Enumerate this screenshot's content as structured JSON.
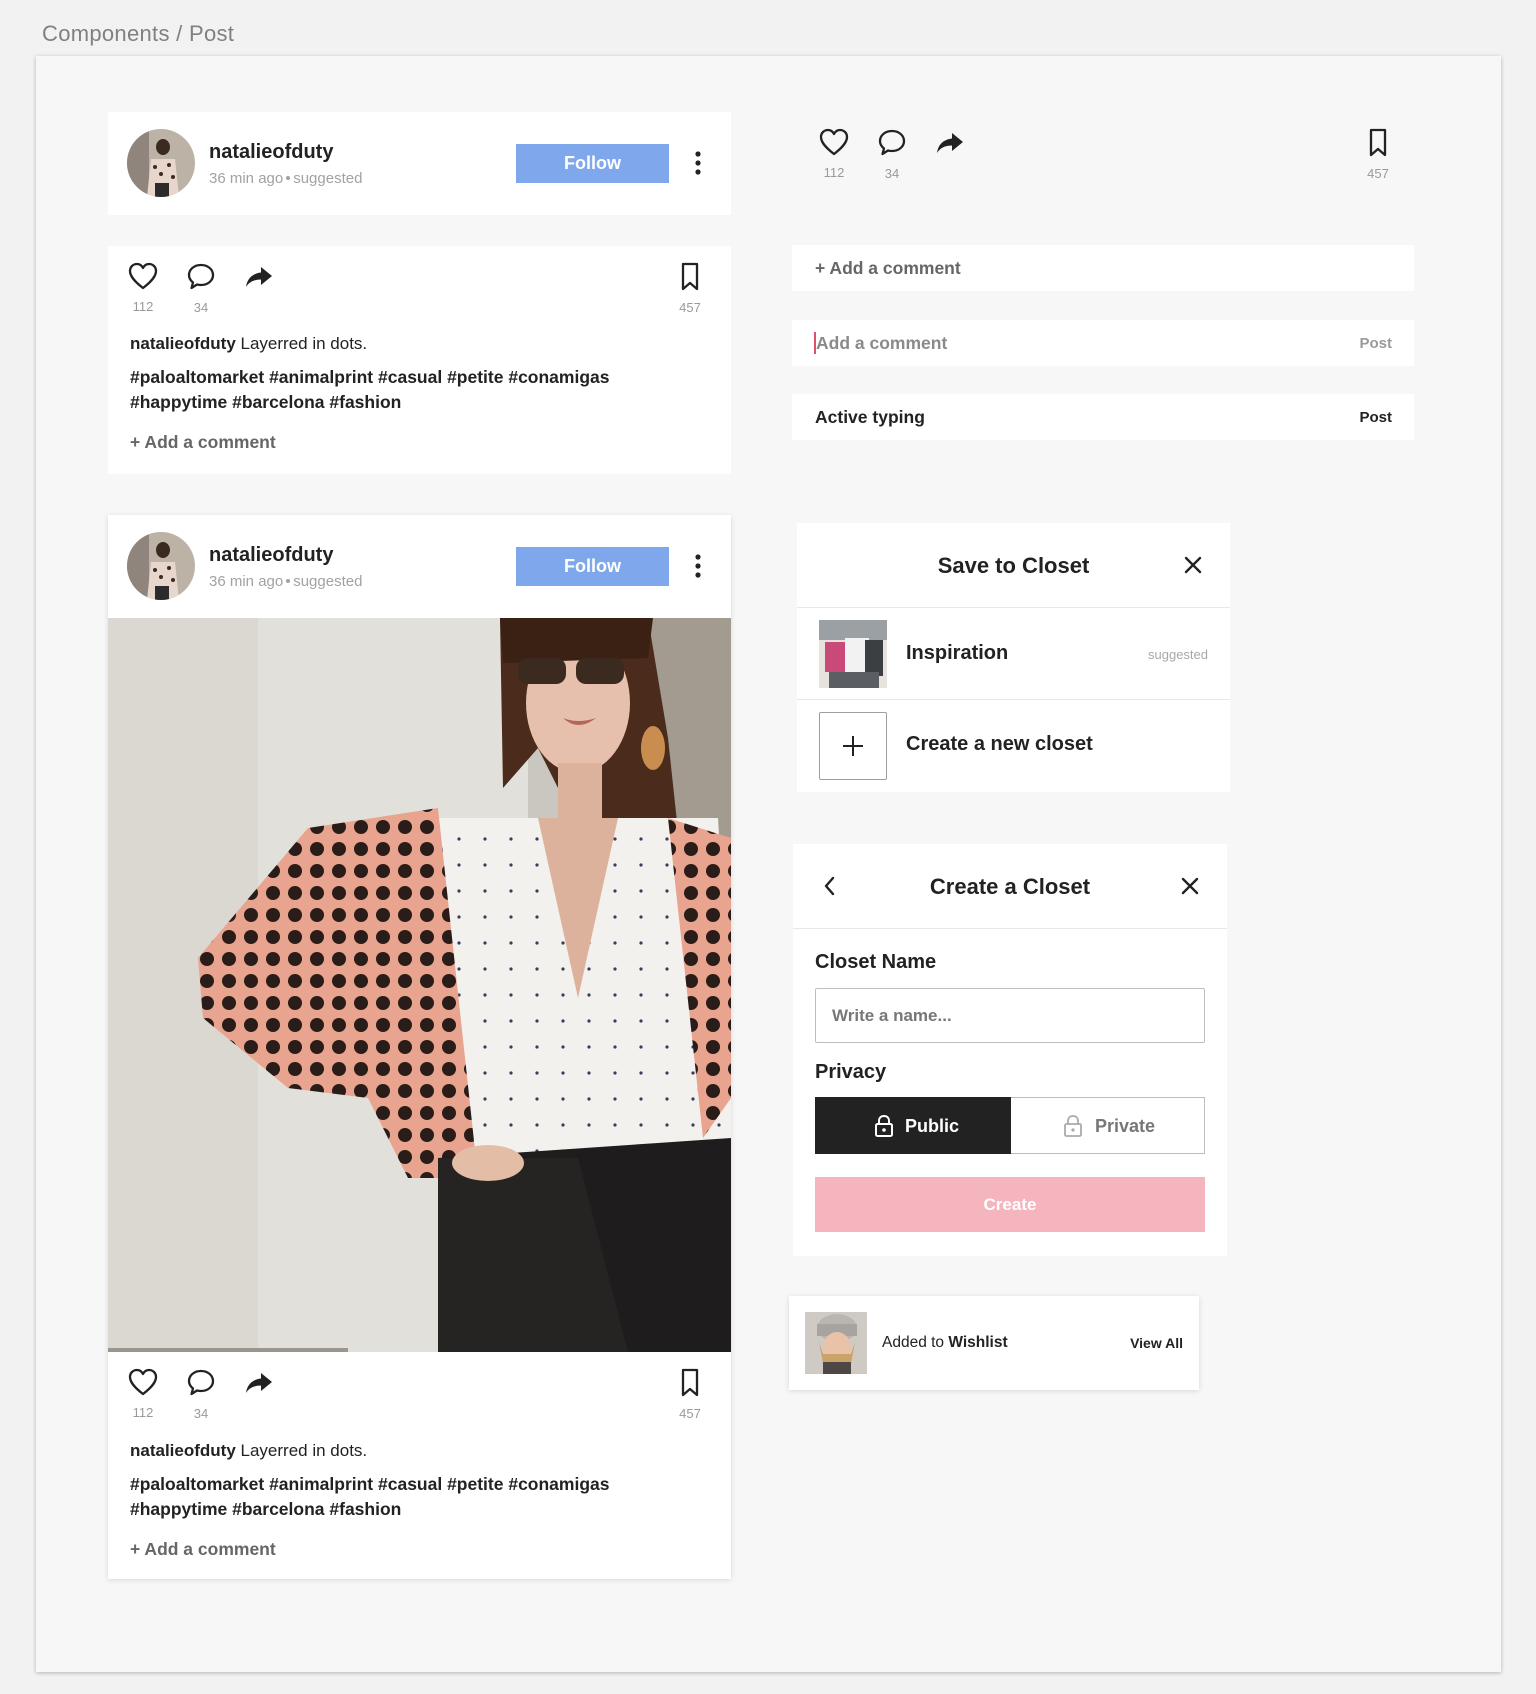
{
  "breadcrumb": "Components / Post",
  "post": {
    "username": "natalieofduty",
    "time": "36 min ago",
    "suggested": "suggested",
    "follow_label": "Follow",
    "likes": "112",
    "comments": "34",
    "saves": "457",
    "caption_user": "natalieofduty",
    "caption_text": " Layerred in dots.",
    "hashtags_line1": "#paloaltomarket #animalprint #casual #petite #conamigas",
    "hashtags_line2": "#happytime #barcelona #fashion",
    "add_comment": "+ Add a comment"
  },
  "actions_panel": {
    "likes": "112",
    "comments": "34",
    "saves": "457"
  },
  "comment_bars": {
    "add_comment": "+ Add a comment",
    "placeholder": "Add a comment",
    "active_text": "Active typing",
    "post_label": "Post"
  },
  "save_closet": {
    "title": "Save to Closet",
    "item_name": "Inspiration",
    "item_badge": "suggested",
    "create_label": "Create a new closet"
  },
  "create_closet": {
    "title": "Create a Closet",
    "name_label": "Closet Name",
    "name_placeholder": "Write a name...",
    "privacy_label": "Privacy",
    "public_label": "Public",
    "private_label": "Private",
    "create_label": "Create"
  },
  "toast": {
    "prefix": "Added to ",
    "target": "Wishlist",
    "action": "View All"
  },
  "colors": {
    "follow_blue": "#7ea8eb",
    "create_pink": "#f5b5be",
    "selected_dark": "#222222"
  }
}
